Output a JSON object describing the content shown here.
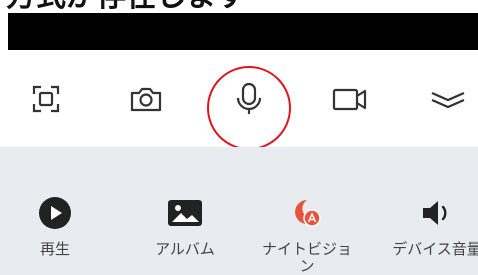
{
  "caption": "方式が存在します",
  "toolbar": {
    "icons": [
      "fullscreen-icon",
      "camera-icon",
      "microphone-icon",
      "video-camera-icon",
      "collapse-chevrons-icon"
    ],
    "highlight_color": "#e0161e"
  },
  "panel": {
    "items": [
      {
        "label": "再生",
        "icon": "play-icon"
      },
      {
        "label": "アルバム",
        "icon": "album-icon"
      },
      {
        "label": "ナイトビジョン",
        "icon": "night-vision-icon"
      },
      {
        "label": "デバイス音量",
        "icon": "speaker-icon"
      }
    ],
    "accent_color": "#e8533a"
  }
}
